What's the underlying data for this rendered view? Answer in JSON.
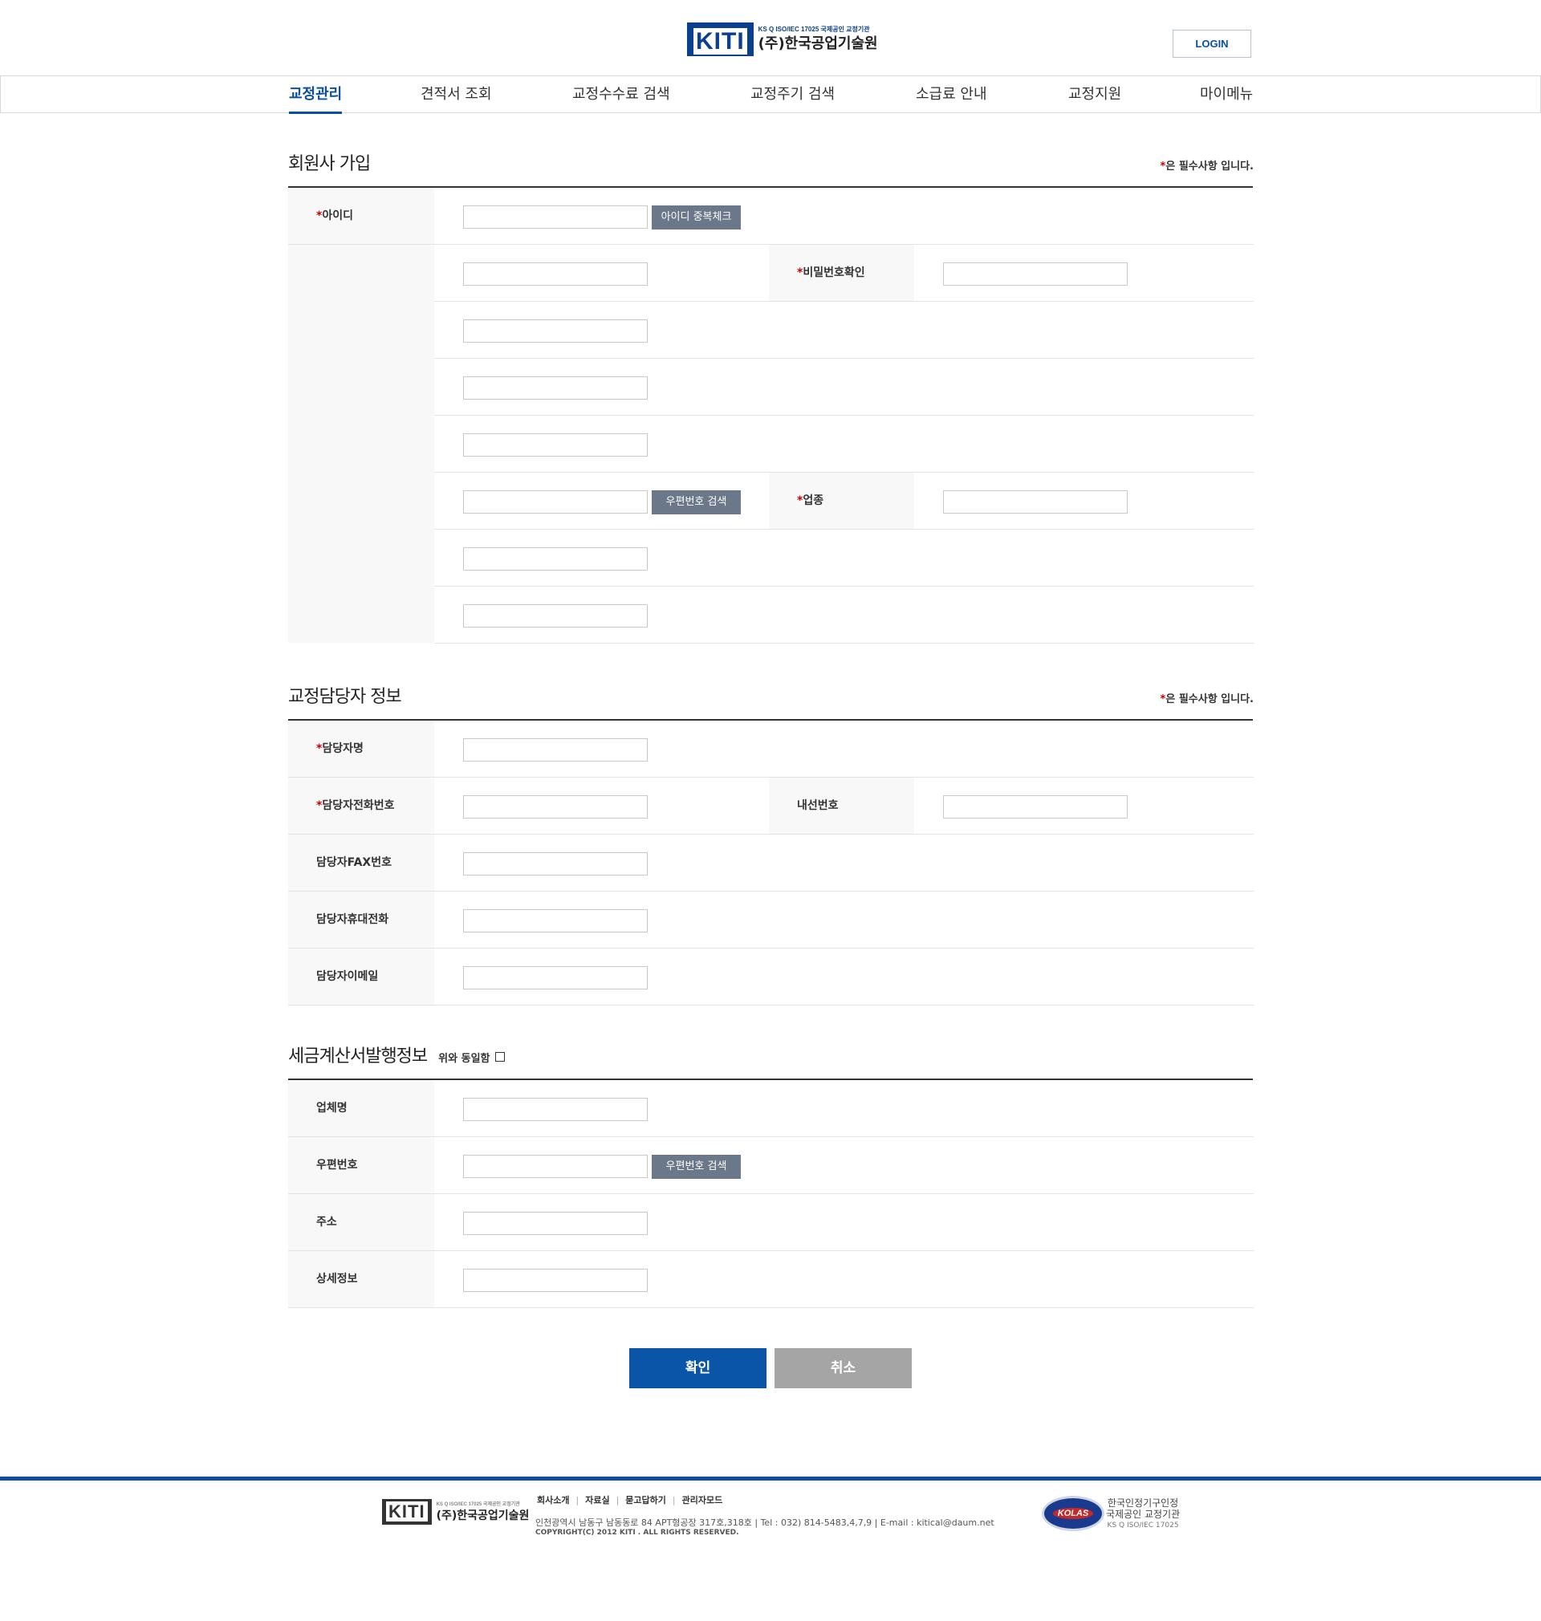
{
  "header": {
    "logo_mark": "KITI",
    "logo_sub": "KS Q ISO/IEC 17025 국제공인 교정기관",
    "logo_name": "(주)한국공업기술원",
    "login_label": "LOGIN"
  },
  "nav": {
    "items": [
      {
        "label": "교정관리"
      },
      {
        "label": "견적서 조회"
      },
      {
        "label": "교정수수료 검색"
      },
      {
        "label": "교정주기 검색"
      },
      {
        "label": "소급료 안내"
      },
      {
        "label": "교정지원"
      },
      {
        "label": "마이메뉴"
      }
    ]
  },
  "member_section": {
    "title": "회원사 가입",
    "required_star": "*",
    "required_note": "은 필수사항 입니다.",
    "id_label": "아이디",
    "id_check_button": "아이디 중복체크",
    "password_confirm_label": "비밀번호확인",
    "zip_search_button": "우편번호 검색",
    "industry_label": "업종"
  },
  "contact_section": {
    "title": "교정담당자 정보",
    "required_star": "*",
    "required_note": "은 필수사항 입니다.",
    "name_label": "담당자명",
    "phone_label": "담당자전화번호",
    "extension_label": "내선번호",
    "fax_label": "담당자FAX번호",
    "mobile_label": "담당자휴대전화",
    "email_label": "담당자이메일"
  },
  "tax_section": {
    "title": "세금계산서발행정보",
    "same_as_above": "위와 동일함",
    "company_label": "업체명",
    "zip_label": "우편번호",
    "zip_search_button": "우편번호 검색",
    "address_label": "주소",
    "detail_label": "상세정보"
  },
  "actions": {
    "confirm": "확인",
    "cancel": "취소"
  },
  "footer": {
    "logo_mark": "KITI",
    "logo_sub": "KS Q ISO/IEC 17025 국제공인 교정기관",
    "logo_name": "(주)한국공업기술원",
    "links": [
      "회사소개",
      "자료실",
      "묻고답하기",
      "관리자모드"
    ],
    "address": "인천광역시 남동구 남동동로 84 APT형공장 317호,318호 | Tel : 032) 814-5483,4,7,9  | E-mail : kitical@daum.net",
    "copyright": "COPYRIGHT(C) 2012 KITI . ALL RIGHTS RESERVED.",
    "kolas_mark": "KOLAS",
    "kolas_line1": "한국인정기구인정",
    "kolas_line2": "국제공인 교정기관",
    "kolas_line3": "KS Q ISO/IEC 17025"
  },
  "colors": {
    "brand_blue": "#0b4fa3",
    "button_gray": "#6b7889",
    "cancel_gray": "#a5a5a5",
    "required_red": "#cc0000"
  }
}
